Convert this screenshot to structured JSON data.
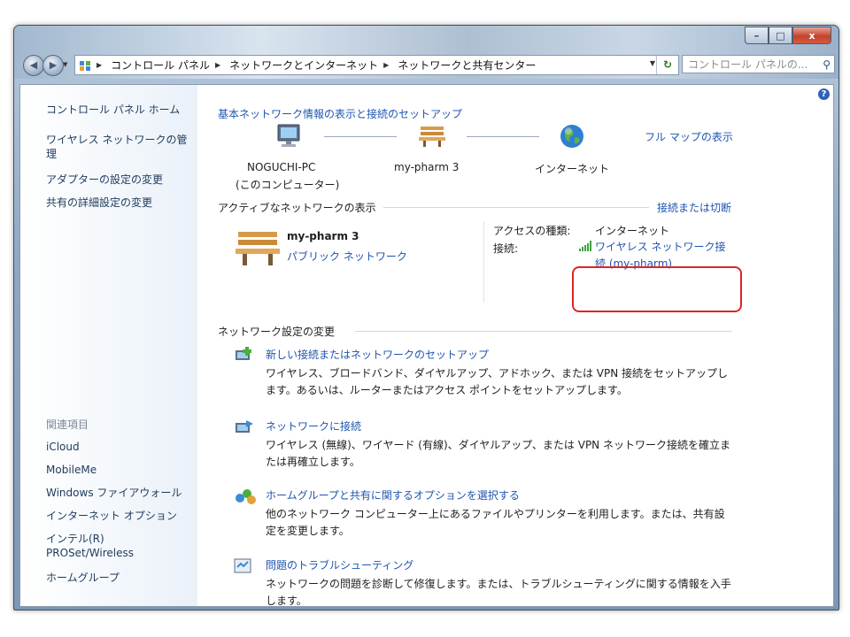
{
  "titlebar": {
    "buttons": {
      "minimize": "–",
      "maximize": "□",
      "close": "x"
    }
  },
  "nav": {
    "back_icon": "back-arrow-icon",
    "forward_icon": "forward-arrow-icon",
    "breadcrumb": [
      "コントロール パネル",
      "ネットワークとインターネット",
      "ネットワークと共有センター"
    ],
    "search_placeholder": "コントロール パネルの..."
  },
  "sidebar": {
    "links": [
      "コントロール パネル ホーム",
      "ワイヤレス ネットワークの管理",
      "アダプターの設定の変更",
      "共有の詳細設定の変更"
    ],
    "see_also_label": "関連項目",
    "see_also": [
      "iCloud",
      "MobileMe",
      "Windows ファイアウォール",
      "インターネット オプション",
      "インテル(R) PROSet/Wireless",
      "ホームグループ"
    ]
  },
  "main": {
    "heading": "基本ネットワーク情報の表示と接続のセットアップ",
    "full_map_link": "フル マップの表示",
    "map_nodes": [
      {
        "label": "NOGUCHI-PC",
        "sub": "(このコンピューター)",
        "icon": "computer-icon"
      },
      {
        "label": "my-pharm 3",
        "icon": "bench-icon"
      },
      {
        "label": "インターネット",
        "icon": "globe-icon"
      }
    ],
    "active_networks_title": "アクティブなネットワークの表示",
    "connect_disconnect_link": "接続または切断",
    "network": {
      "name": "my-pharm 3",
      "type": "パブリック ネットワーク",
      "access_type_label": "アクセスの種類:",
      "access_type_value": "インターネット",
      "connection_label": "接続:",
      "connection_value": "ワイヤレス ネットワーク接続 (my-pharm)"
    },
    "change_settings_title": "ネットワーク設定の変更",
    "tasks": [
      {
        "icon": "new-connection-icon",
        "title": "新しい接続またはネットワークのセットアップ",
        "description": "ワイヤレス、ブロードバンド、ダイヤルアップ、アドホック、または VPN 接続をセットアップします。あるいは、ルーターまたはアクセス ポイントをセットアップします。"
      },
      {
        "icon": "connect-network-icon",
        "title": "ネットワークに接続",
        "description": "ワイヤレス (無線)、ワイヤード (有線)、ダイヤルアップ、または VPN ネットワーク接続を確立または再確立します。"
      },
      {
        "icon": "homegroup-icon",
        "title": "ホームグループと共有に関するオプションを選択する",
        "description": "他のネットワーク コンピューター上にあるファイルやプリンターを利用します。または、共有設定を変更します。"
      },
      {
        "icon": "troubleshoot-icon",
        "title": "問題のトラブルシューティング",
        "description": "ネットワークの問題を診断して修復します。または、トラブルシューティングに関する情報を入手します。"
      }
    ]
  },
  "colors": {
    "link": "#1f55b0",
    "highlight": "#e02424"
  }
}
